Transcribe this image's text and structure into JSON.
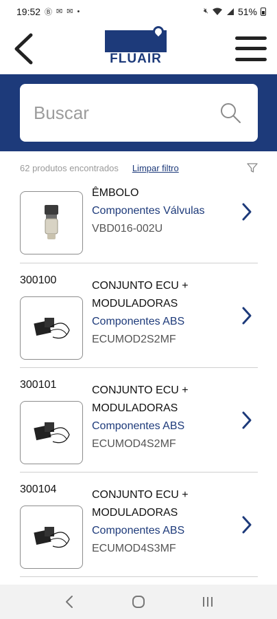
{
  "status_bar": {
    "time": "19:52",
    "left_icons": [
      "b-icon",
      "mail-icon",
      "mail-icon",
      "dot"
    ],
    "battery": "51%"
  },
  "header": {
    "logo_text": "FLUAIR",
    "brand_color": "#1d3a7a"
  },
  "search": {
    "placeholder": "Buscar"
  },
  "filter": {
    "result_count": "62 produtos encontrados",
    "clear_label": "Limpar filtro"
  },
  "products": [
    {
      "code": "",
      "name": "ÊMBOLO",
      "category": "Componentes Válvulas",
      "sku": "VBD016-002U",
      "image": "valve-piston"
    },
    {
      "code": "300100",
      "name": "CONJUNTO ECU + MODULADORAS",
      "category": "Componentes ABS",
      "sku": "ECUMOD2S2MF",
      "image": "ecu-modulator"
    },
    {
      "code": "300101",
      "name": "CONJUNTO ECU + MODULADORAS",
      "category": "Componentes ABS",
      "sku": "ECUMOD4S2MF",
      "image": "ecu-modulator"
    },
    {
      "code": "300104",
      "name": "CONJUNTO ECU + MODULADORAS",
      "category": "Componentes ABS",
      "sku": "ECUMOD4S3MF",
      "image": "ecu-modulator"
    }
  ]
}
